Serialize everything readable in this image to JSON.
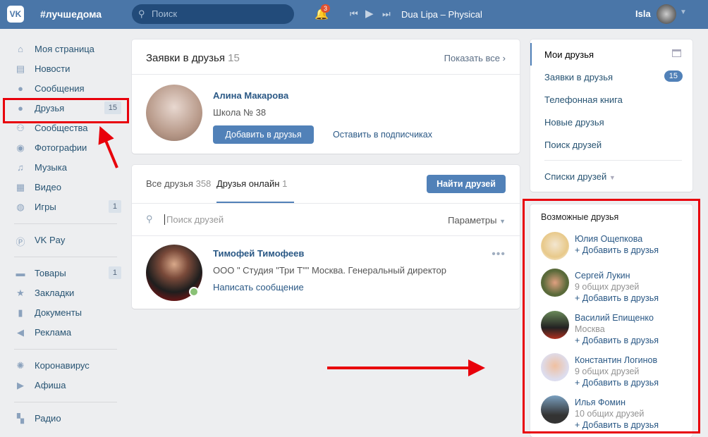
{
  "header": {
    "logo": "VK",
    "brand": "#лучшедома",
    "search_placeholder": "Поиск",
    "notif_count": "3",
    "track": "Dua Lipa – Physical",
    "user": "Isla"
  },
  "left_menu": [
    {
      "label": "Моя страница",
      "icon": "home-icon"
    },
    {
      "label": "Новости",
      "icon": "news-icon"
    },
    {
      "label": "Сообщения",
      "icon": "messages-icon"
    },
    {
      "label": "Друзья",
      "icon": "user-icon",
      "count": "15"
    },
    {
      "label": "Сообщества",
      "icon": "groups-icon"
    },
    {
      "label": "Фотографии",
      "icon": "camera-icon"
    },
    {
      "label": "Музыка",
      "icon": "music-icon"
    },
    {
      "label": "Видео",
      "icon": "video-icon"
    },
    {
      "label": "Игры",
      "icon": "gamepad-icon",
      "count": "1"
    },
    {
      "label": "VK Pay",
      "icon": "vkpay-icon"
    },
    {
      "label": "Товары",
      "icon": "bag-icon",
      "count": "1"
    },
    {
      "label": "Закладки",
      "icon": "star-icon"
    },
    {
      "label": "Документы",
      "icon": "document-icon"
    },
    {
      "label": "Реклама",
      "icon": "megaphone-icon"
    },
    {
      "label": "Коронавирус",
      "icon": "virus-icon"
    },
    {
      "label": "Афиша",
      "icon": "play-icon"
    },
    {
      "label": "Радио",
      "icon": "radio-icon"
    }
  ],
  "requests": {
    "title": "Заявки в друзья",
    "count": "15",
    "show_all": "Показать все",
    "name": "Алина Макарова",
    "school": "Школа № 38",
    "add": "Добавить в друзья",
    "keep": "Оставить в подписчиках"
  },
  "friends": {
    "tab_all": "Все друзья",
    "tab_all_count": "358",
    "tab_online": "Друзья онлайн",
    "tab_online_count": "1",
    "find": "Найти друзей",
    "search_placeholder": "Поиск друзей",
    "params": "Параметры",
    "name": "Тимофей Тимофеев",
    "job": "ООО \" Студия \"Три Т\"\" Москва. Генеральный директор",
    "write": "Написать сообщение"
  },
  "right_menu": {
    "items": [
      "Мои друзья",
      "Заявки в друзья",
      "Телефонная книга",
      "Новые друзья",
      "Поиск друзей"
    ],
    "req_count": "15",
    "lists": "Списки друзей"
  },
  "suggestions": {
    "title": "Возможные друзья",
    "add": "+ Добавить в друзья",
    "people": [
      {
        "name": "Юлия Ощепкова",
        "sub": ""
      },
      {
        "name": "Сергей Лукин",
        "sub": "9 общих друзей"
      },
      {
        "name": "Василий Епищенко",
        "sub": "Москва"
      },
      {
        "name": "Константин Логинов",
        "sub": "9 общих друзей"
      },
      {
        "name": "Илья Фомин",
        "sub": "10 общих друзей"
      }
    ]
  },
  "colors": {
    "header": "#4a76a8",
    "accent": "#5181b8",
    "highlight": "#e8000b"
  }
}
